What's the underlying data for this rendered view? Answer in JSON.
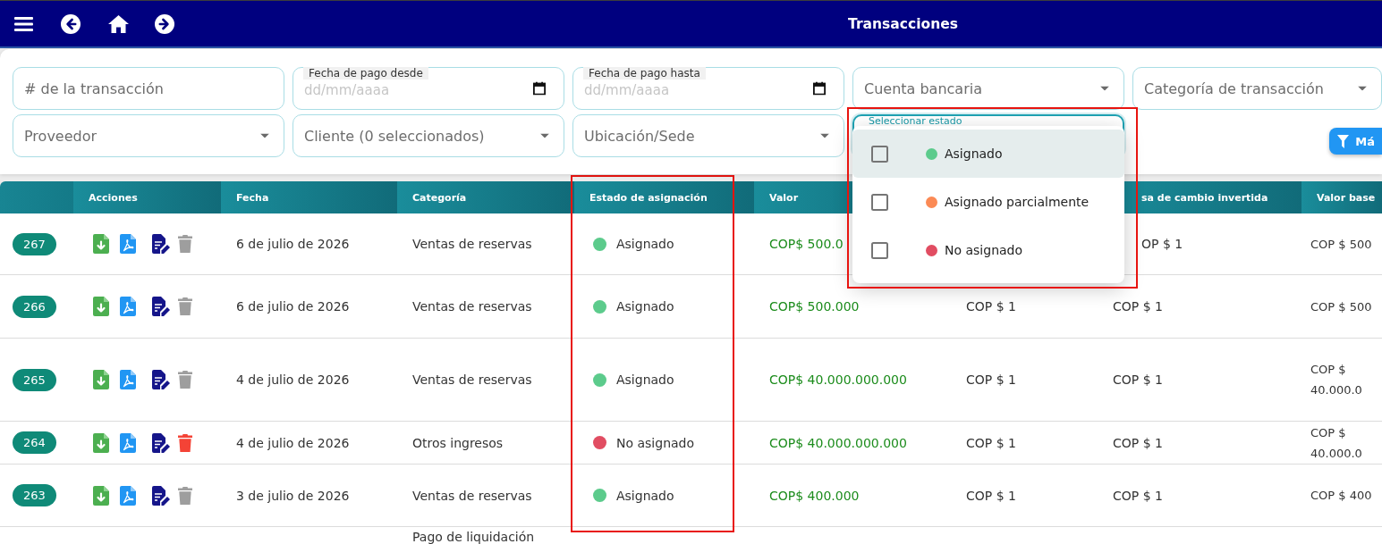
{
  "top_bar": {
    "title": "Transacciones"
  },
  "filters": [
    {
      "kind": "text",
      "placeholder": "# de la transacción"
    },
    {
      "kind": "date",
      "label": "Fecha de pago desde",
      "placeholder": "dd/mm/aaaa"
    },
    {
      "kind": "date",
      "label": "Fecha de pago hasta",
      "placeholder": "dd/mm/aaaa"
    },
    {
      "kind": "select",
      "placeholder": "Cuenta bancaria"
    },
    {
      "kind": "select",
      "placeholder": "Categoría de transacción"
    },
    {
      "kind": "select",
      "placeholder": "Proveedor"
    },
    {
      "kind": "select",
      "placeholder": "Cliente (0 seleccionados)"
    },
    {
      "kind": "select",
      "placeholder": "Ubicación/Sede"
    },
    {
      "kind": "multiselect",
      "label": "Seleccionar estado",
      "expanded": true,
      "annotated": true,
      "options": [
        {
          "label": "Asignado",
          "color": "#5ccb8c",
          "checked": false,
          "focused": true
        },
        {
          "label": "Asignado parcialmente",
          "color": "#fb8a55",
          "checked": false,
          "focused": false
        },
        {
          "label": "No asignado",
          "color": "#e14d62",
          "checked": false,
          "focused": false
        }
      ]
    }
  ],
  "more_filters_button": {
    "label": "Má"
  },
  "table": {
    "columns": [
      {
        "label": "Acciones",
        "annotated": false
      },
      {
        "label": "Fecha",
        "annotated": false
      },
      {
        "label": "Categoría",
        "annotated": false
      },
      {
        "label": "Estado de asignación",
        "annotated": true
      },
      {
        "label": "Valor",
        "annotated": false
      },
      {
        "label": "sa de cambio invertida",
        "annotated": false
      },
      {
        "label": "Valor base",
        "annotated": false
      }
    ],
    "rows": [
      {
        "number": "267",
        "delete_disabled": true,
        "date": "6 de julio de 2026",
        "category": "Ventas de reservas",
        "status": {
          "label": "Asignado",
          "color": "#5ccb8c"
        },
        "value": "COP$ 500.0",
        "inverse_rate": "OP $ 1",
        "base_value": "COP $ 500"
      },
      {
        "number": "266",
        "delete_disabled": true,
        "date": "6 de julio de 2026",
        "category": "Ventas de reservas",
        "status": {
          "label": "Asignado",
          "color": "#5ccb8c"
        },
        "value": "COP$ 500.000",
        "column_7": "COP $ 1",
        "inverse_rate": "COP $ 1",
        "base_value": "COP $ 500"
      },
      {
        "number": "265",
        "delete_disabled": true,
        "date": "4 de julio de 2026",
        "category": "Ventas de reservas",
        "status": {
          "label": "Asignado",
          "color": "#5ccb8c"
        },
        "value": "COP$ 40.000.000.000",
        "column_7": "COP $ 1",
        "inverse_rate": "COP $ 1",
        "base_value": "COP $ 40.000.0"
      },
      {
        "number": "264",
        "delete_disabled": false,
        "date": "4 de julio de 2026",
        "category": "Otros ingresos",
        "status": {
          "label": "No asignado",
          "color": "#e14d62"
        },
        "value": "COP$ 40.000.000.000",
        "column_7": "COP $ 1",
        "inverse_rate": "COP $ 1",
        "base_value": "COP $ 40.000.0"
      },
      {
        "number": "263",
        "delete_disabled": true,
        "date": "3 de julio de 2026",
        "category": "Ventas de reservas",
        "status": {
          "label": "Asignado",
          "color": "#5ccb8c"
        },
        "value": "COP$ 400.000",
        "column_7": "COP $ 1",
        "inverse_rate": "COP $ 1",
        "base_value": "COP $ 400"
      },
      {
        "category": "Pago de liquidación"
      }
    ]
  }
}
